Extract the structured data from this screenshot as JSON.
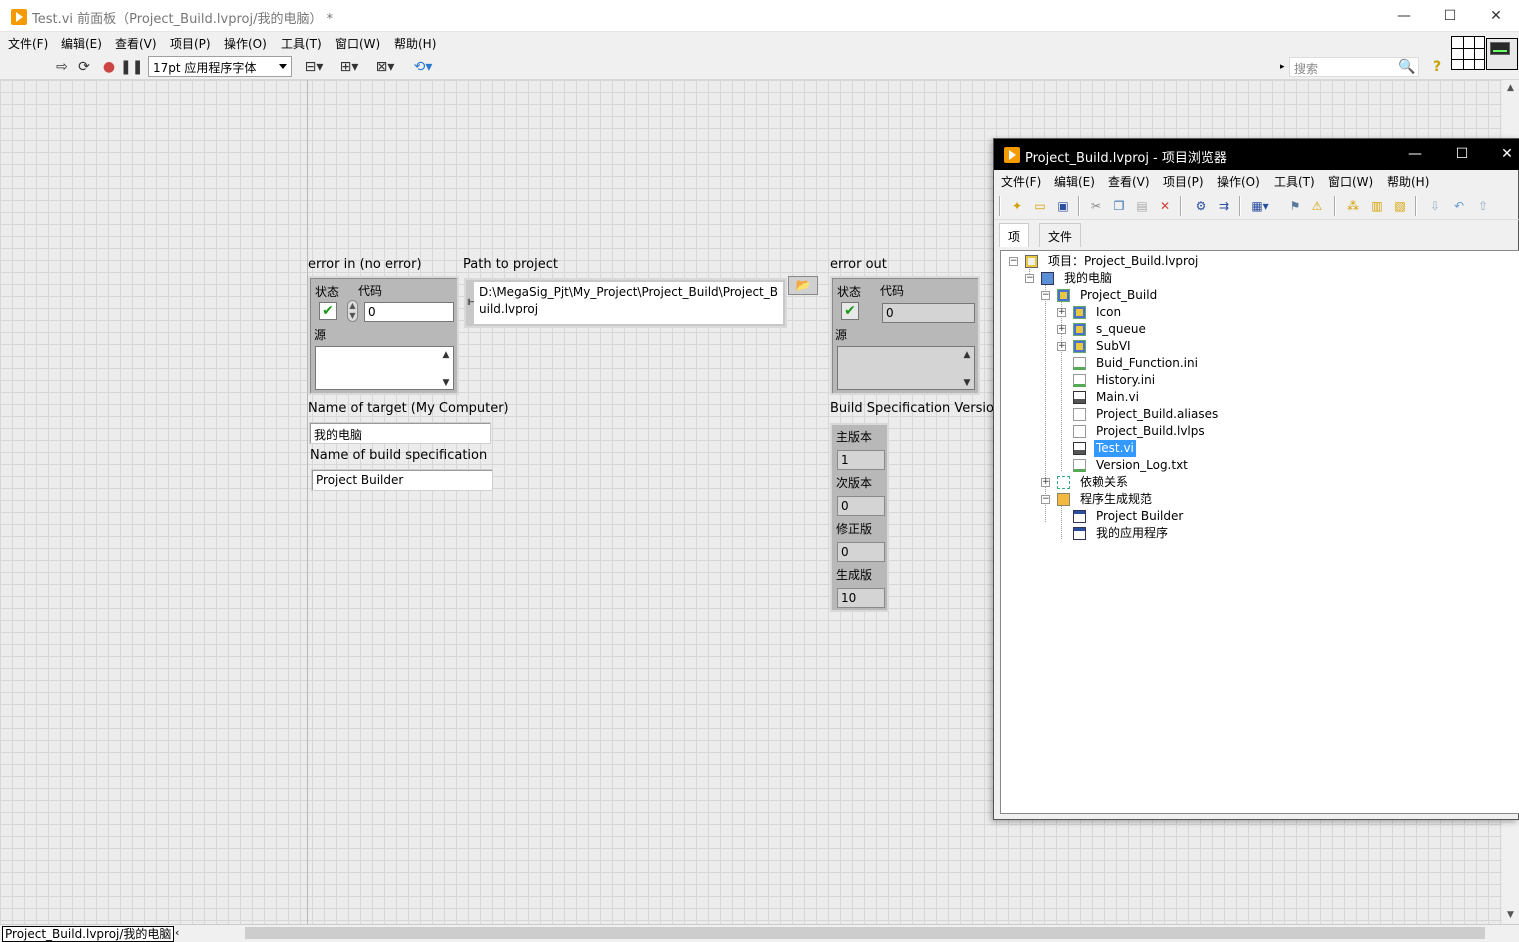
{
  "window": {
    "title": "Test.vi 前面板（Project_Build.lvproj/我的电脑） *",
    "minimize": "—",
    "maximize": "☐",
    "close": "✕"
  },
  "menu": [
    "文件(F)",
    "编辑(E)",
    "查看(V)",
    "项目(P)",
    "操作(O)",
    "工具(T)",
    "窗口(W)",
    "帮助(H)"
  ],
  "toolbar": {
    "font": "17pt 应用程序字体",
    "search_placeholder": "搜索",
    "icons": [
      "run-arrow-icon",
      "run-continuously-icon",
      "abort-icon",
      "pause-icon",
      "align-icon",
      "distribute-icon",
      "resize-icon",
      "reorder-icon",
      "search-icon",
      "help-icon"
    ]
  },
  "panel": {
    "error_in": {
      "label": "error in (no error)",
      "status_label": "状态",
      "code_label": "代码",
      "code_value": "0",
      "source_label": "源",
      "status_mark": "✔"
    },
    "path": {
      "label": "Path to project",
      "value": "D:\\MegaSig_Pjt\\My_Project\\Project_Build\\Project_Build.lvproj",
      "browse_icon": "📂"
    },
    "error_out": {
      "label": "error out",
      "status_label": "状态",
      "code_label": "代码",
      "code_value": "0",
      "source_label": "源",
      "status_mark": "✔"
    },
    "target": {
      "label": "Name of target (My Computer)",
      "value": "我的电脑"
    },
    "build_spec": {
      "label": "Name of build specification",
      "value": "Project Builder"
    },
    "version": {
      "label": "Build Specification Version",
      "fields": [
        {
          "label": "主版本",
          "value": "1"
        },
        {
          "label": "次版本",
          "value": "0"
        },
        {
          "label": "修正版",
          "value": "0"
        },
        {
          "label": "生成版",
          "value": "10"
        }
      ]
    }
  },
  "status_bar": {
    "context": "Project_Build.lvproj/我的电脑"
  },
  "project": {
    "title": "Project_Build.lvproj - 项目浏览器",
    "menu": [
      "文件(F)",
      "编辑(E)",
      "查看(V)",
      "项目(P)",
      "操作(O)",
      "工具(T)",
      "窗口(W)",
      "帮助(H)"
    ],
    "tabs": [
      "项",
      "文件"
    ],
    "tree": [
      {
        "label": "项目：Project_Build.lvproj",
        "icon": "project-icon"
      },
      {
        "label": "我的电脑",
        "icon": "computer-icon"
      },
      {
        "label": "Project_Build",
        "icon": "folder-icon"
      },
      {
        "label": "Icon",
        "icon": "folder-icon"
      },
      {
        "label": "s_queue",
        "icon": "folder-icon"
      },
      {
        "label": "SubVI",
        "icon": "folder-icon"
      },
      {
        "label": "Buid_Function.ini",
        "icon": "ini-file-icon"
      },
      {
        "label": "History.ini",
        "icon": "ini-file-icon"
      },
      {
        "label": "Main.vi",
        "icon": "vi-icon"
      },
      {
        "label": "Project_Build.aliases",
        "icon": "file-icon"
      },
      {
        "label": "Project_Build.lvlps",
        "icon": "file-icon"
      },
      {
        "label": "Test.vi",
        "icon": "vi-icon"
      },
      {
        "label": "Version_Log.txt",
        "icon": "txt-file-icon"
      },
      {
        "label": "依赖关系",
        "icon": "dependencies-icon"
      },
      {
        "label": "程序生成规范",
        "icon": "build-specs-icon"
      },
      {
        "label": "Project Builder",
        "icon": "build-spec-icon"
      },
      {
        "label": "我的应用程序",
        "icon": "build-spec-icon"
      }
    ],
    "selected": "Test.vi"
  }
}
